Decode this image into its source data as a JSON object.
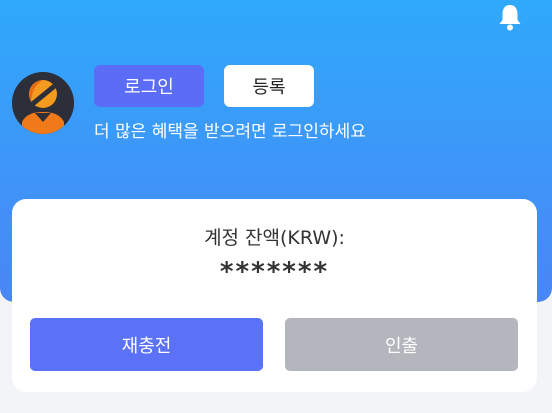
{
  "header": {
    "login_label": "로그인",
    "register_label": "등록",
    "promo_text": "더 많은 혜택을 받으려면 로그인하세요",
    "bell_icon": "bell-icon",
    "avatar_icon": "user-avatar-icon"
  },
  "account": {
    "balance_label": "계정 잔액(KRW):",
    "balance_value": "*******",
    "recharge_label": "재충전",
    "withdraw_label": "인출"
  },
  "colors": {
    "header_top": "#2fa9fb",
    "header_bottom": "#4a86f5",
    "login_button": "#5b6cf6",
    "recharge_button": "#5b72f6",
    "withdraw_button": "#b4b6bd"
  }
}
